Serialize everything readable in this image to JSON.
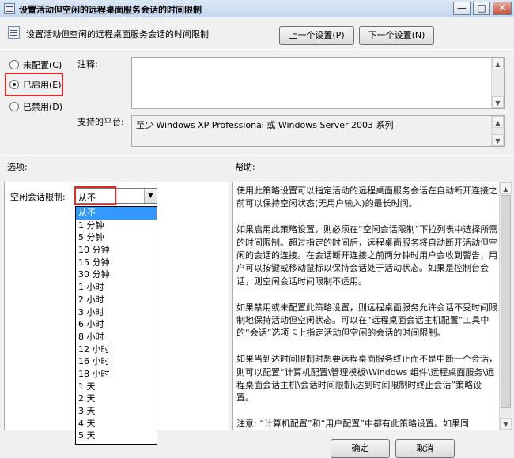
{
  "window": {
    "title": "设置活动但空闲的远程桌面服务会话的时间限制",
    "minimize": "—",
    "maximize": "□",
    "close": "✕"
  },
  "header": {
    "title": "设置活动但空闲的远程桌面服务会话的时间限制",
    "prev_button": "上一个设置(P)",
    "next_button": "下一个设置(N)"
  },
  "state": {
    "not_configured": "未配置(C)",
    "enabled": "已启用(E)",
    "disabled": "已禁用(D)",
    "selected": "enabled"
  },
  "comment": {
    "label": "注释:",
    "value": ""
  },
  "platform": {
    "label": "支持的平台:",
    "value": "至少 Windows XP Professional 或 Windows Server 2003 系列"
  },
  "options": {
    "header": "选项:",
    "limit_label": "空闲会话限制:",
    "selected_value": "从不",
    "items": [
      "从不",
      "1 分钟",
      "5 分钟",
      "10 分钟",
      "15 分钟",
      "30 分钟",
      "1 小时",
      "2 小时",
      "3 小时",
      "6 小时",
      "8 小时",
      "12 小时",
      "16 小时",
      "18 小时",
      "1 天",
      "2 天",
      "3 天",
      "4 天",
      "5 天"
    ]
  },
  "help": {
    "header": "帮助:",
    "paragraphs": [
      "使用此策略设置可以指定活动的远程桌面服务会话在自动断开连接之前可以保持空闲状态(无用户输入)的最长时间。",
      "如果启用此策略设置，则必须在“空闲会话限制”下拉列表中选择所需的时间限制。超过指定的时间后，远程桌面服务将自动断开活动但空闲的会话的连接。在会话断开连接之前两分钟时用户会收到警告，用户可以按键或移动鼠标以保持会话处于活动状态。如果是控制台会话，则空闲会话时间限制不适用。",
      "如果禁用或未配置此策略设置，则远程桌面服务允许会话不受时间限制地保持活动但空闲状态。可以在“远程桌面会话主机配置”工具中的“会话”选项卡上指定活动但空闲的会话的时间限制。",
      "如果当到达时间限制时想要远程桌面服务终止而不是中断一个会话，则可以配置“计算机配置\\管理模板\\Windows 组件\\远程桌面服务\\远程桌面会话主机\\会话时间限制\\达到时间限制时终止会话”策略设置。",
      "注意: “计算机配置”和“用户配置”中都有此策略设置。如果同"
    ]
  },
  "footer": {
    "ok": "确定",
    "cancel": "取消"
  }
}
